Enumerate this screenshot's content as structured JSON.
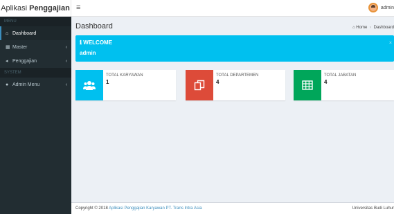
{
  "app": {
    "title_prefix": "Aplikasi",
    "title_bold": "Penggajian"
  },
  "topbar": {
    "toggle_glyph": "≡",
    "user_name": "admin"
  },
  "sidebar": {
    "section_menu": "MENU",
    "items": [
      {
        "label": "Dashboard",
        "icon": "⌂"
      },
      {
        "label": "Master",
        "icon": "▦",
        "chevron": "‹"
      },
      {
        "label": "Penggajian",
        "icon": "◂",
        "chevron": "‹"
      }
    ],
    "section_admin": "SYSTEM",
    "admin_item": {
      "label": "Admin Menu",
      "icon": "●",
      "chevron": "‹"
    }
  },
  "content": {
    "title": "Dashboard",
    "breadcrumb": {
      "home": "Home",
      "current": "Dashboard"
    },
    "welcome": {
      "heading": "WELCOME",
      "user": "admin",
      "close": "×"
    },
    "boxes": [
      {
        "label": "TOTAL KARYAWAN",
        "value": "1",
        "color": "#00c0ef",
        "icon": "users-icon"
      },
      {
        "label": "TOTAL DEPARTEMEN",
        "value": "4",
        "color": "#dd4b39",
        "icon": "copy-icon"
      },
      {
        "label": "TOTAL JABATAN",
        "value": "4",
        "color": "#00a65a",
        "icon": "table-icon"
      }
    ]
  },
  "footer": {
    "copyright": "Copyright © 2018",
    "link": "Aplikasi Penggajian Karyawan PT. Trans Intra Asia",
    "right": "Universitas Budi Luhur"
  }
}
